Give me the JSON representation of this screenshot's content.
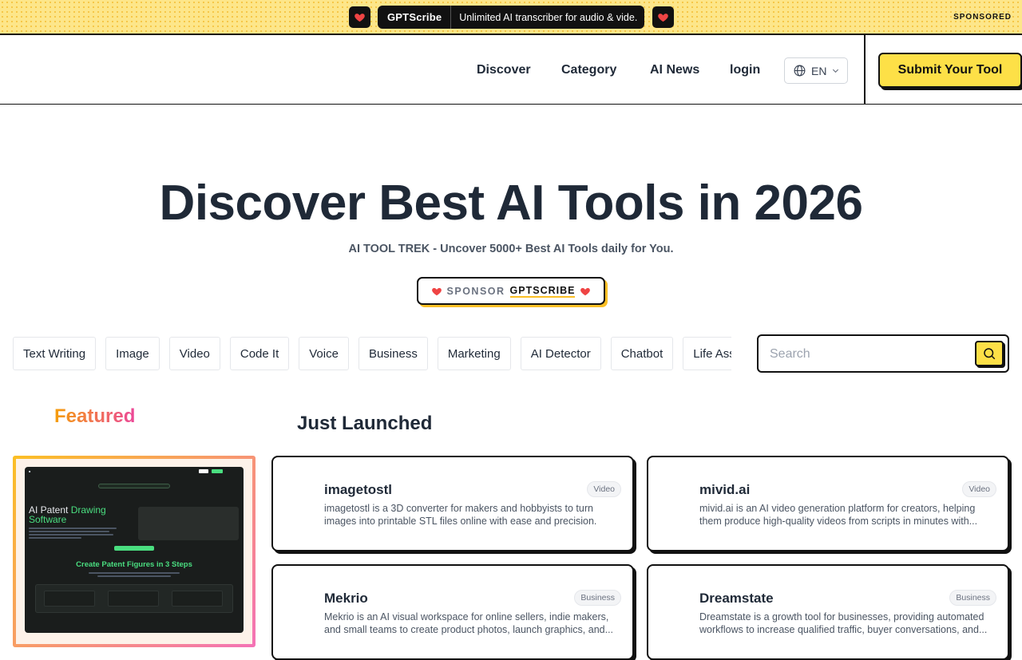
{
  "topbar": {
    "brand": "GPTScribe",
    "tagline": "Unlimited AI transcriber for audio & vide.",
    "sponsored_label": "SPONSORED"
  },
  "nav": {
    "links": [
      "Discover",
      "Category",
      "AI News",
      "login"
    ],
    "language": "EN",
    "submit_label": "Submit Your Tool"
  },
  "hero": {
    "title": "Discover Best AI Tools in 2026",
    "subtitle": "AI TOOL TREK - Uncover 5000+ Best AI Tools daily for You.",
    "sponsor_label": "SPONSOR",
    "sponsor_name": "GPTSCRIBE"
  },
  "categories": [
    "Text Writing",
    "Image",
    "Video",
    "Code It",
    "Voice",
    "Business",
    "Marketing",
    "AI Detector",
    "Chatbot",
    "Life Assistant"
  ],
  "search": {
    "placeholder": "Search"
  },
  "featured": {
    "title": "Featured",
    "preview": {
      "heading_white": "AI Patent ",
      "heading_green_1": "Drawing",
      "heading_green_2": "Software",
      "section_title": "Create Patent Figures in 3 Steps"
    }
  },
  "just_launched": {
    "title": "Just Launched",
    "tools": [
      {
        "name": "imagetostl",
        "tag": "Video",
        "description": "imagetostl is a 3D converter for makers and hobbyists to turn images into printable STL files online with ease and precision."
      },
      {
        "name": "mivid.ai",
        "tag": "Video",
        "description": "mivid.ai is an AI video generation platform for creators, helping them produce high-quality videos from scripts in minutes with..."
      },
      {
        "name": "Mekrio",
        "tag": "Business",
        "description": "Mekrio is an AI visual workspace for online sellers, indie makers, and small teams to create product photos, launch graphics, and..."
      },
      {
        "name": "Dreamstate",
        "tag": "Business",
        "description": "Dreamstate is a growth tool for businesses, providing automated workflows to increase qualified traffic, buyer conversations, and..."
      }
    ]
  },
  "colors": {
    "accent_yellow": "#fde047",
    "ink": "#111111",
    "heart_red": "#ef4444"
  }
}
